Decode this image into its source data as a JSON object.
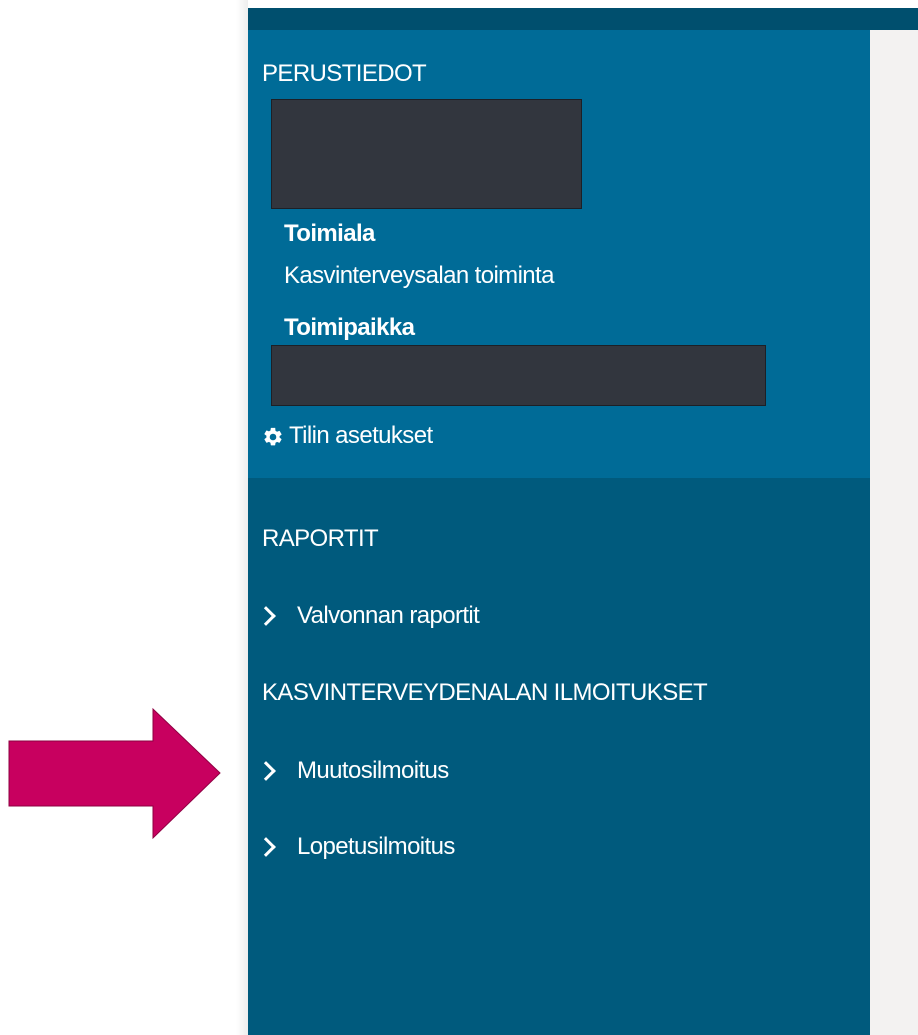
{
  "sidebar": {
    "basic_info": {
      "heading": "PERUSTIEDOT",
      "industry_label": "Toimiala",
      "industry_value": "Kasvinterveysalan toiminta",
      "location_label": "Toimipaikka",
      "settings_label": "Tilin asetukset",
      "settings_icon": "gear-icon"
    },
    "reports": {
      "heading": "RAPORTIT",
      "items": [
        {
          "label": "Valvonnan raportit",
          "icon": "chevron-right-icon"
        }
      ]
    },
    "notifications": {
      "heading": "KASVINTERVEYDENALAN ILMOITUKSET",
      "items": [
        {
          "label": "Muutosilmoitus",
          "icon": "chevron-right-icon"
        },
        {
          "label": "Lopetusilmoitus",
          "icon": "chevron-right-icon"
        }
      ]
    }
  },
  "annotation": {
    "arrow_color": "#c8005f",
    "arrow_icon": "arrow-right-icon"
  },
  "colors": {
    "sidebar_bg": "#005a7d",
    "basic_info_bg": "#006b97",
    "top_strip": "#004f6e",
    "content_bg": "#f3f2f1",
    "redaction": "#32363e"
  }
}
